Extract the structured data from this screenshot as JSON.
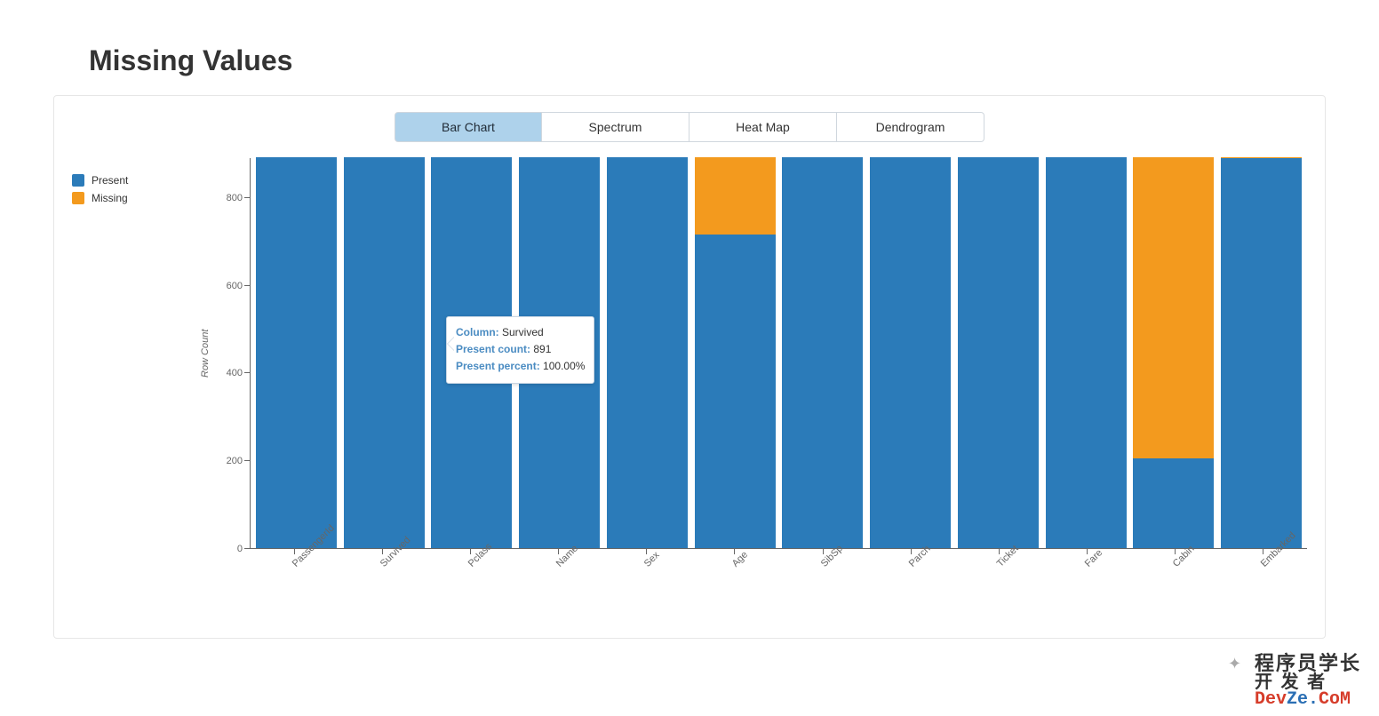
{
  "title": "Missing Values",
  "tabs": [
    "Bar Chart",
    "Spectrum",
    "Heat Map",
    "Dendrogram"
  ],
  "active_tab": 0,
  "legend": {
    "present": "Present",
    "missing": "Missing"
  },
  "colors": {
    "present": "#2b7bb9",
    "missing": "#f39a1e",
    "tab_active": "#aed2eb"
  },
  "ylabel": "Row Count",
  "yticks": [
    0,
    200,
    400,
    600,
    800
  ],
  "ymax": 891,
  "tooltip": {
    "column_key": "Column:",
    "column_val": "Survived",
    "count_key": "Present count:",
    "count_val": "891",
    "percent_key": "Present percent:",
    "percent_val": "100.00%"
  },
  "watermark": {
    "chinese": "程序员学长",
    "dev_prefix": "Dev",
    "dev_mid": "Ze.",
    "dev_suffix": "CoM",
    "kaifazhe": "开 发 者"
  },
  "chart_data": {
    "type": "bar",
    "stacked": true,
    "title": "Missing Values",
    "xlabel": "",
    "ylabel": "Row Count",
    "ylim": [
      0,
      891
    ],
    "categories": [
      "PassengerId",
      "Survived",
      "Pclass",
      "Name",
      "Sex",
      "Age",
      "SibSp",
      "Parch",
      "Ticket",
      "Fare",
      "Cabin",
      "Embarked"
    ],
    "series": [
      {
        "name": "Present",
        "color": "#2b7bb9",
        "values": [
          891,
          891,
          891,
          891,
          891,
          714,
          891,
          891,
          891,
          891,
          204,
          889
        ]
      },
      {
        "name": "Missing",
        "color": "#f39a1e",
        "values": [
          0,
          0,
          0,
          0,
          0,
          177,
          0,
          0,
          0,
          0,
          687,
          2
        ]
      }
    ],
    "legend_position": "top-left"
  }
}
